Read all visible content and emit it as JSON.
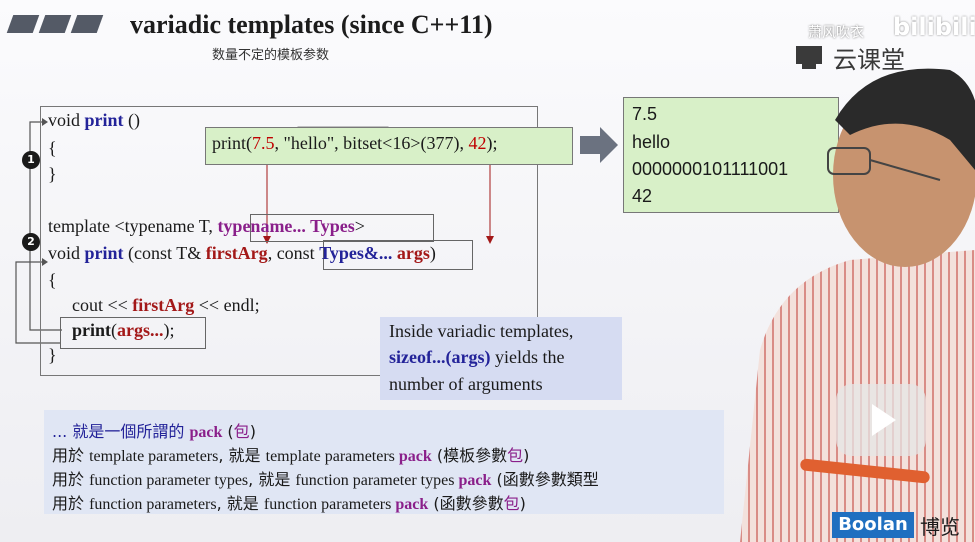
{
  "header": {
    "title": "variadic templates (since C++11)",
    "subtitle": "数量不定的模板参数"
  },
  "watermark": {
    "uploader": "萧风吹衣",
    "site": "bilibili",
    "brand": "云课堂"
  },
  "markers": {
    "one": "1",
    "two": "2"
  },
  "code": {
    "line1": {
      "pre": "void ",
      "kw": "print",
      "post": " ()"
    },
    "line2": "{",
    "line3": "}",
    "line4": {
      "pre": "template <typename T, ",
      "kw": "typename... Types",
      "post": ">"
    },
    "line5": {
      "pre": "void ",
      "kw": "print",
      "mid": " (const T& ",
      "red": "firstArg",
      "comma": ", const ",
      "kw2": "Types&...",
      "sp": " ",
      "red2": "args",
      "post": ")"
    },
    "line6": "{",
    "line7": {
      "pre": "cout << ",
      "red": "firstArg",
      "post": " << endl;"
    },
    "line8": {
      "kw": "print",
      "paren": "(",
      "red": "args...",
      "post": ");"
    },
    "line9": "}"
  },
  "call": {
    "pre": "print(",
    "n1": "7.5",
    "mid": ", \"hello\", bitset<16>(377), ",
    "n2": "42",
    "post": ");"
  },
  "output": [
    "7.5",
    "hello",
    "0000000101111001",
    "42"
  ],
  "note": {
    "line1": "Inside variadic templates,",
    "line2_bold": "sizeof...(args)",
    "line2_rest": " yields the",
    "line3": "number of arguments"
  },
  "pack": {
    "l1_a": "... 就是一個所謂的 ",
    "l1_pack": "pack",
    "l1_b": " (",
    "l1_bao": "包",
    "l1_c": ")",
    "l2_a": "用於 ",
    "l2_b": "template parameters",
    "l2_c": ", 就是 ",
    "l2_d": "template parameters ",
    "l2_pack": "pack",
    "l2_e": " (模板參數",
    "l2_bao": "包",
    "l2_f": ")",
    "l3_a": "用於 ",
    "l3_b": "function parameter types",
    "l3_c": ", 就是 ",
    "l3_d": "function parameter types ",
    "l3_pack": "pack",
    "l3_e": " (函數參數類型",
    "l4_a": "用於 ",
    "l4_b": "function parameters",
    "l4_c": ", 就是 ",
    "l4_d": "function parameters ",
    "l4_pack": "pack",
    "l4_e": " (函數參數",
    "l4_bao": "包",
    "l4_f": ")"
  },
  "footer": {
    "logo": "Boolan",
    "chinese": "博览"
  }
}
